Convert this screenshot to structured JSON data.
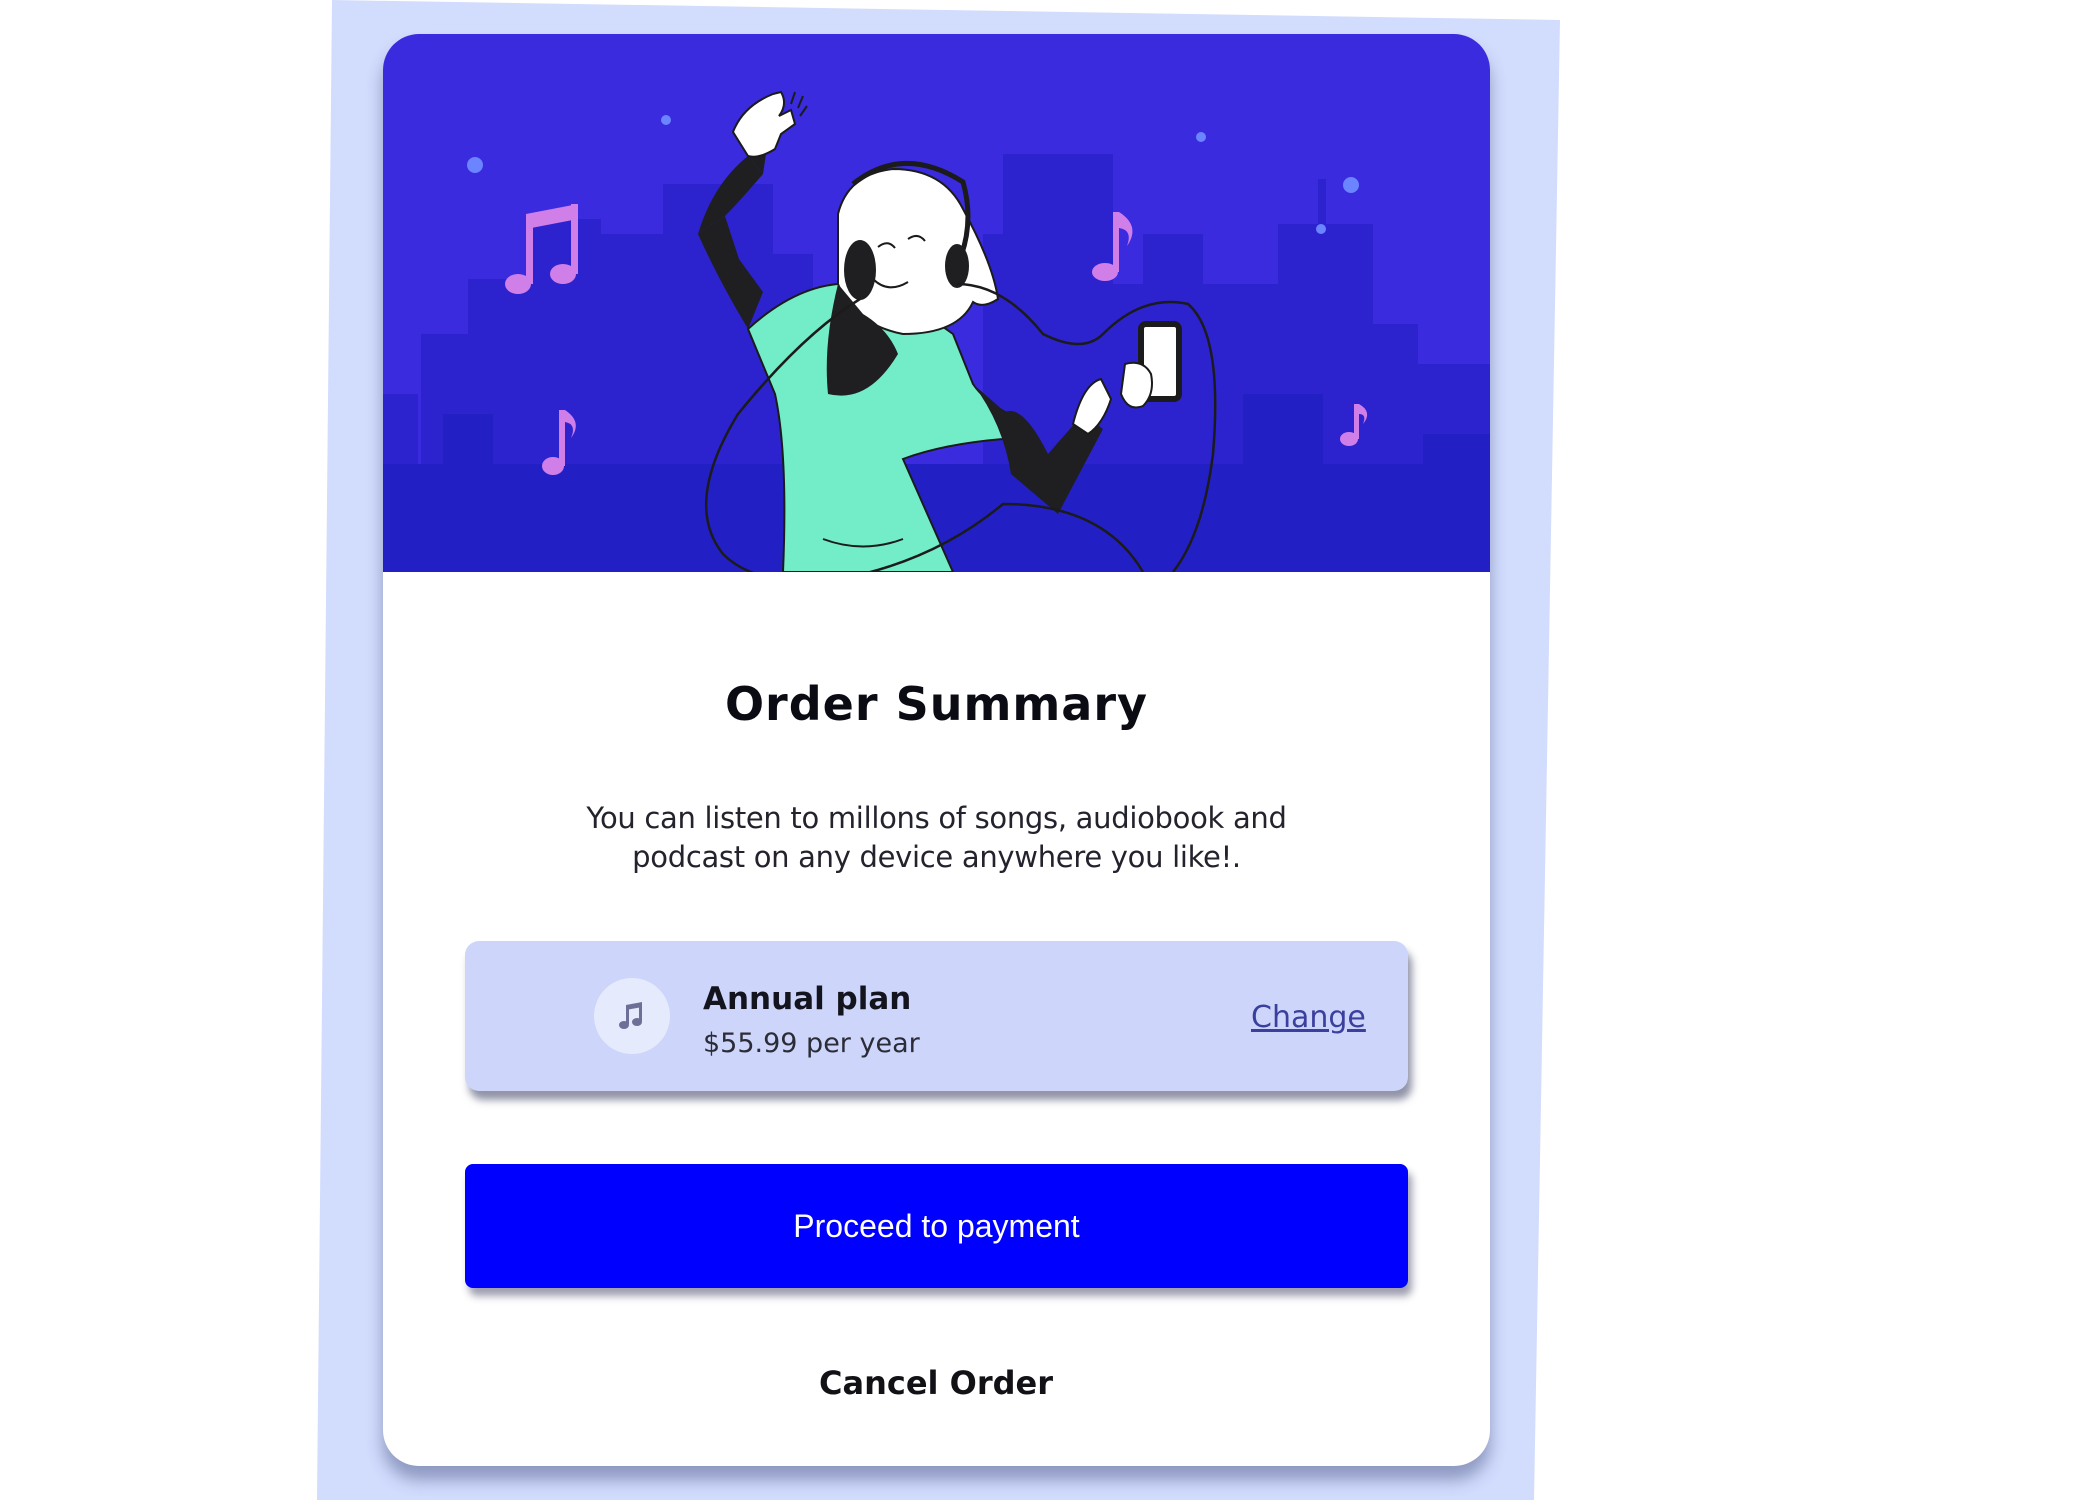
{
  "colors": {
    "page_background": "#ffffff",
    "backdrop": "#d2dcfd",
    "card_background": "#ffffff",
    "hero_background": "#3a2bde",
    "plan_box": "#cdd6fa",
    "primary_button": "#0000ff",
    "link": "#3b3f9e"
  },
  "hero": {
    "illustration": "person-dancing-with-headphones-and-phone-illustration",
    "icons": [
      "music-notes-icon",
      "music-note-icon"
    ]
  },
  "order": {
    "title": "Order Summary",
    "description": "You can listen to millons of songs, audiobook and podcast on any device anywhere you like!."
  },
  "plan": {
    "icon": "music-note-icon",
    "name": "Annual plan",
    "price": "$55.99 per year",
    "change_label": "Change"
  },
  "actions": {
    "proceed_label": "Proceed to payment",
    "cancel_label": "Cancel Order"
  }
}
